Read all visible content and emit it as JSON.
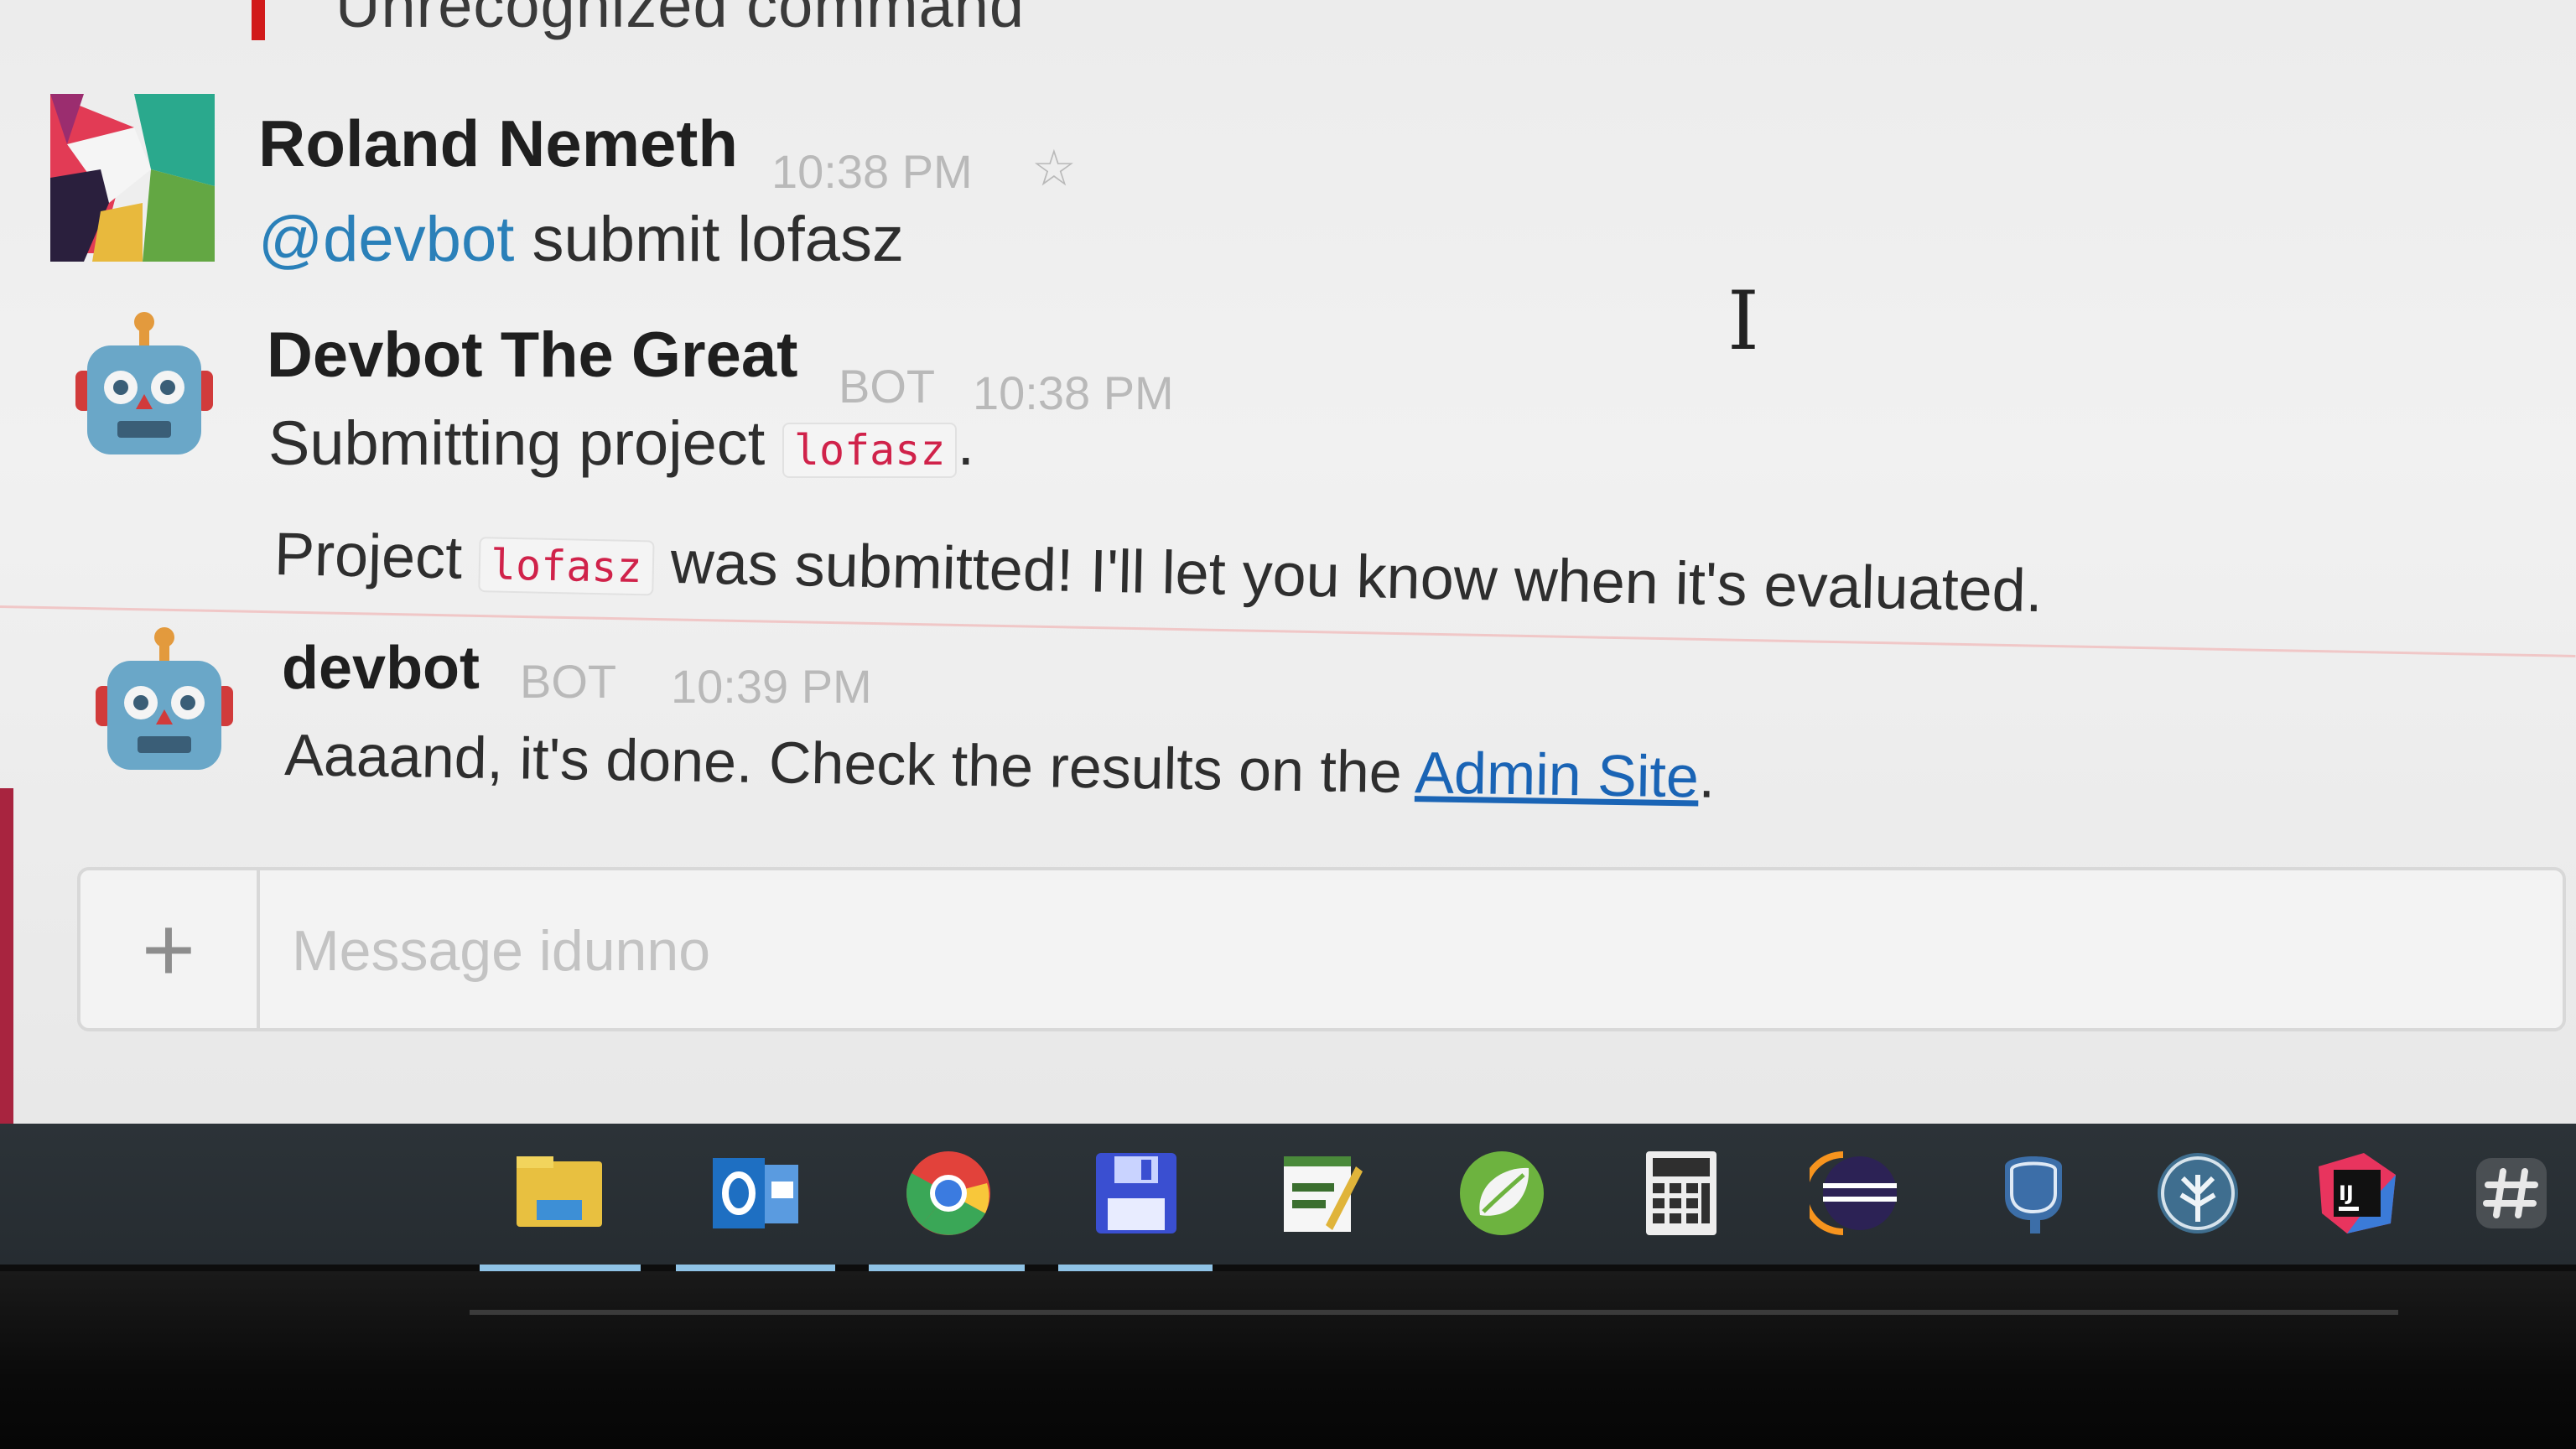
{
  "previous_message": {
    "text": "Unrecognized command"
  },
  "messages": [
    {
      "author": "Roland Nemeth",
      "time": "10:38 PM",
      "star_icon": "star-outline-icon",
      "mention": "@devbot",
      "text": " submit lofasz"
    },
    {
      "author": "Devbot The Great",
      "badge": "BOT",
      "time": "10:38 PM",
      "line1_prefix": "Submitting project ",
      "line1_code": "lofasz",
      "line1_suffix": ".",
      "line2_prefix": "Project ",
      "line2_code": "lofasz",
      "line2_suffix": " was submitted! I'll let you know when it's evaluated."
    },
    {
      "author": "devbot",
      "badge": "BOT",
      "time": "10:39 PM",
      "text_prefix": "Aaaand, it's done. Check the results on the ",
      "link_text": "Admin Site",
      "text_suffix": "."
    }
  ],
  "composer": {
    "plus_label": "+",
    "placeholder": "Message idunno"
  },
  "taskbar": {
    "apps": [
      {
        "name": "file-explorer-icon"
      },
      {
        "name": "outlook-icon"
      },
      {
        "name": "chrome-icon"
      },
      {
        "name": "save-floppy-icon"
      },
      {
        "name": "notes-editor-icon"
      },
      {
        "name": "spring-leaf-icon"
      },
      {
        "name": "calculator-icon"
      },
      {
        "name": "eclipse-icon"
      },
      {
        "name": "postgresql-elephant-icon"
      },
      {
        "name": "tree-app-icon"
      },
      {
        "name": "intellij-icon"
      },
      {
        "name": "slack-icon"
      }
    ]
  },
  "colors": {
    "mention": "#2a80b9",
    "code": "#d0224a",
    "link": "#1a64b5",
    "taskbar": "#2c3338"
  }
}
